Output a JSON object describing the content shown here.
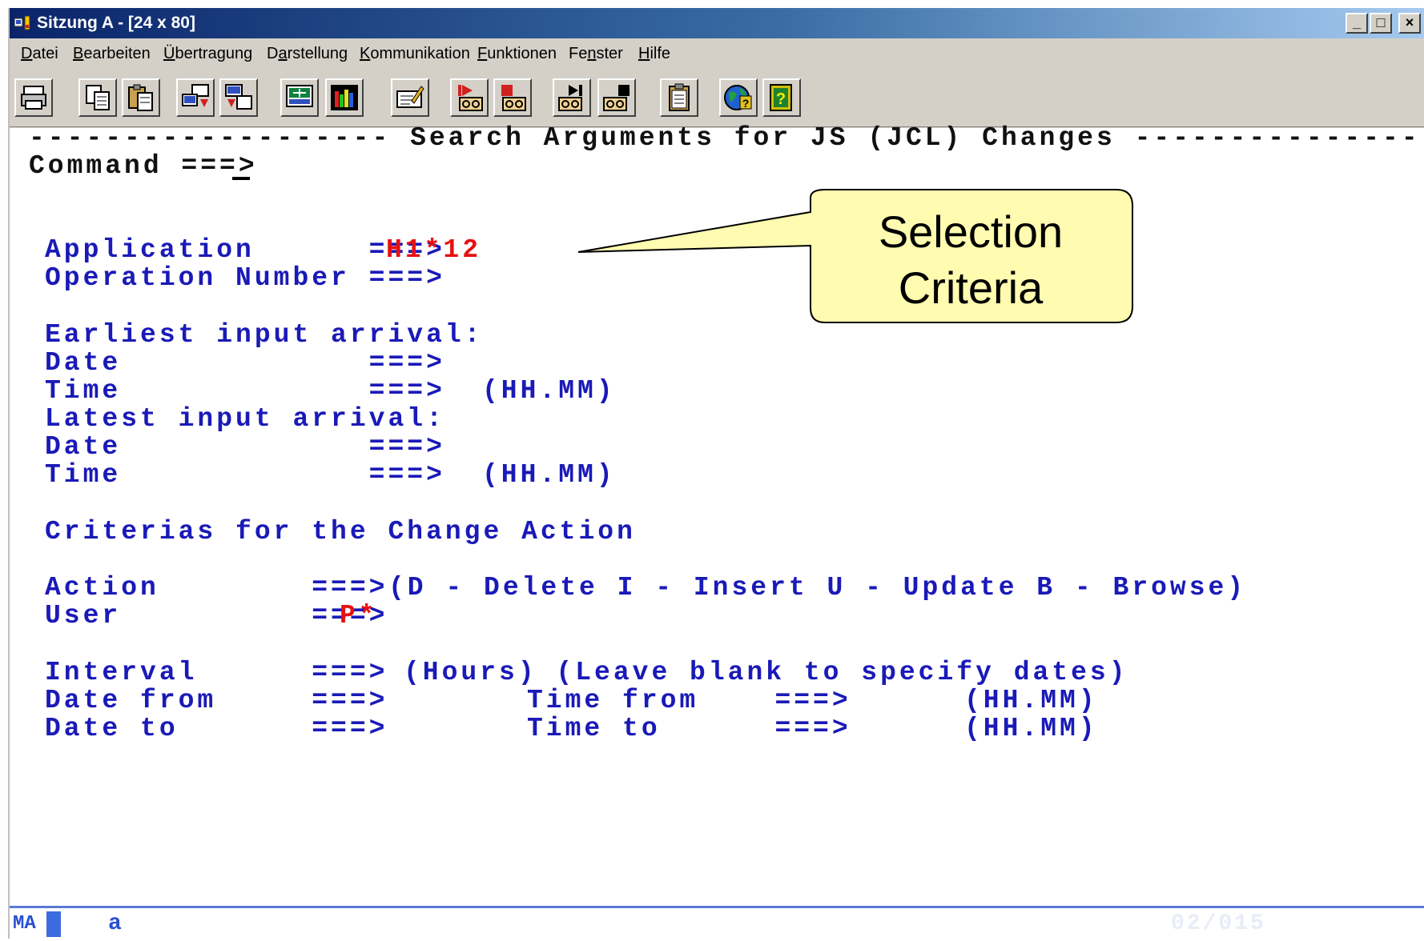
{
  "window": {
    "title": "Sitzung A - [24 x 80]",
    "buttons": {
      "minimize": "_",
      "maximize": "□",
      "close": "×"
    }
  },
  "menu": [
    {
      "pre": "",
      "u": "D",
      "post": "atei"
    },
    {
      "pre": "",
      "u": "B",
      "post": "earbeiten"
    },
    {
      "pre": "",
      "u": "Ü",
      "post": "bertragung"
    },
    {
      "pre": "D",
      "u": "a",
      "post": "rstellung"
    },
    {
      "pre": "",
      "u": "K",
      "post": "ommunikation"
    },
    {
      "pre": "",
      "u": "F",
      "post": "unktionen"
    },
    {
      "pre": "Fe",
      "u": "n",
      "post": "ster"
    },
    {
      "pre": "",
      "u": "H",
      "post": "ilfe"
    }
  ],
  "toolbar": [
    "print-icon",
    "copy-icon",
    "paste-icon",
    "send-file-icon",
    "receive-file-icon",
    "display-setup-icon",
    "color-map-icon",
    "edit-macro-icon",
    "play-macro-icon",
    "record-macro-icon",
    "step-macro-icon",
    "stop-macro-icon",
    "clipboard-icon",
    "help-globe-icon",
    "help-book-icon"
  ],
  "terminal": {
    "header": "------------------- Search Arguments for JS (JCL) Changes ------------------",
    "command_label": "Command ===>",
    "application_label": "Application      ===>",
    "application_value": "H1*12",
    "operation_label": "Operation Number ===>",
    "earliest_label": "Earliest input arrival:",
    "earliest_date_label": "Date             ===>",
    "earliest_time_label": "Time             ===>",
    "earliest_time_fmt": "(HH.MM)",
    "latest_label": "Latest input arrival:",
    "latest_date_label": "Date             ===>",
    "latest_time_label": "Time             ===>",
    "latest_time_fmt": "(HH.MM)",
    "criterias_label": "Criterias for the Change Action",
    "action_label": "Action        ===>",
    "action_hint": "(D - Delete I - Insert U - Update B - Browse)",
    "user_label": "User          ===>",
    "user_value": "P*",
    "interval_label": "Interval      ===>",
    "interval_hint": "(Hours) (Leave blank to specify dates)",
    "date_from_label": "Date from     ===>",
    "time_from_label": "Time from    ===>",
    "time_from_fmt": "(HH.MM)",
    "date_to_label": "Date to       ===>",
    "time_to_label": "Time to      ===>",
    "time_to_fmt": "(HH.MM)"
  },
  "callout": {
    "line1": "Selection",
    "line2": "Criteria"
  },
  "status": {
    "mode": "MA",
    "indicator": "a",
    "position": "02/015"
  }
}
